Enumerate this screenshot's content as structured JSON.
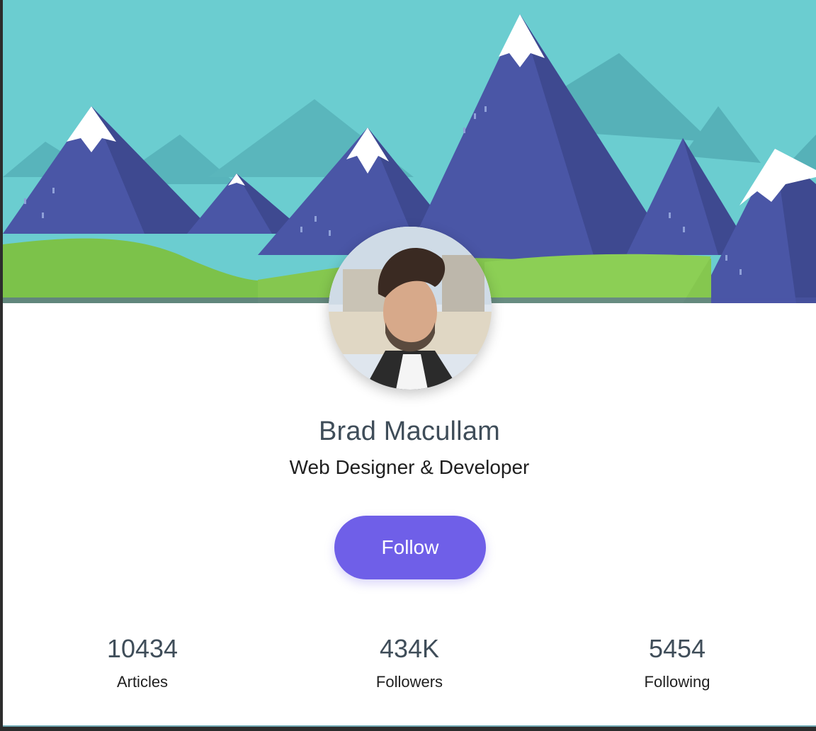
{
  "profile": {
    "name": "Brad Macullam",
    "role": "Web Designer & Developer",
    "follow_label": "Follow"
  },
  "stats": [
    {
      "value": "10434",
      "label": "Articles"
    },
    {
      "value": "434K",
      "label": "Followers"
    },
    {
      "value": "5454",
      "label": "Following"
    }
  ],
  "colors": {
    "accent": "#6f5fe8",
    "sky": "#6bcdd0",
    "mountain": "#4a56a6",
    "grass": "#7cc24a",
    "text_dark": "#3f4d59"
  }
}
